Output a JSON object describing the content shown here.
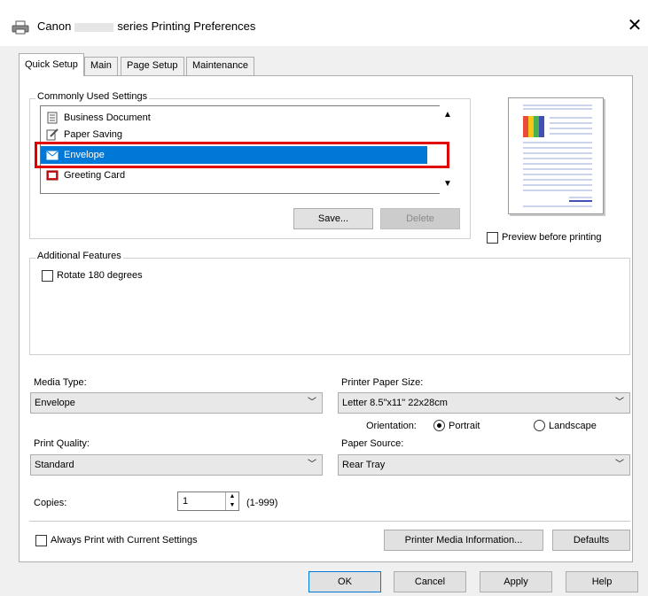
{
  "window": {
    "title_prefix": "Canon",
    "title_suffix": "series Printing Preferences",
    "close_glyph": "✕"
  },
  "tabs": [
    {
      "label": "Quick Setup",
      "active": true
    },
    {
      "label": "Main",
      "active": false
    },
    {
      "label": "Page Setup",
      "active": false
    },
    {
      "label": "Maintenance",
      "active": false
    }
  ],
  "commonly_used": {
    "group_label": "Commonly Used Settings",
    "items": [
      {
        "label": "Business Document",
        "icon": "document-icon",
        "selected": false
      },
      {
        "label": "Paper Saving",
        "icon": "paper-saving-icon",
        "selected": false
      },
      {
        "label": "Envelope",
        "icon": "envelope-icon",
        "selected": true
      },
      {
        "label": "Greeting Card",
        "icon": "greeting-card-icon",
        "selected": false
      }
    ],
    "save_label": "Save...",
    "delete_label": "Delete"
  },
  "preview_before_printing": {
    "label": "Preview before printing",
    "checked": false
  },
  "additional_features": {
    "group_label": "Additional Features",
    "rotate_label": "Rotate 180 degrees",
    "rotate_checked": false
  },
  "media_type": {
    "label": "Media Type:",
    "value": "Envelope"
  },
  "printer_paper_size": {
    "label": "Printer Paper Size:",
    "value": "Letter 8.5\"x11\" 22x28cm"
  },
  "orientation": {
    "label": "Orientation:",
    "portrait_label": "Portrait",
    "landscape_label": "Landscape",
    "selected": "Portrait"
  },
  "print_quality": {
    "label": "Print Quality:",
    "value": "Standard"
  },
  "paper_source": {
    "label": "Paper Source:",
    "value": "Rear Tray"
  },
  "copies": {
    "label": "Copies:",
    "value": "1",
    "range": "(1-999)"
  },
  "always_print": {
    "label": "Always Print with Current Settings",
    "checked": false
  },
  "printer_media_info_label": "Printer Media Information...",
  "defaults_label": "Defaults",
  "footer": {
    "ok": "OK",
    "cancel": "Cancel",
    "apply": "Apply",
    "help": "Help"
  },
  "colors": {
    "selection": "#0078d7",
    "highlight_border": "#e00000"
  }
}
